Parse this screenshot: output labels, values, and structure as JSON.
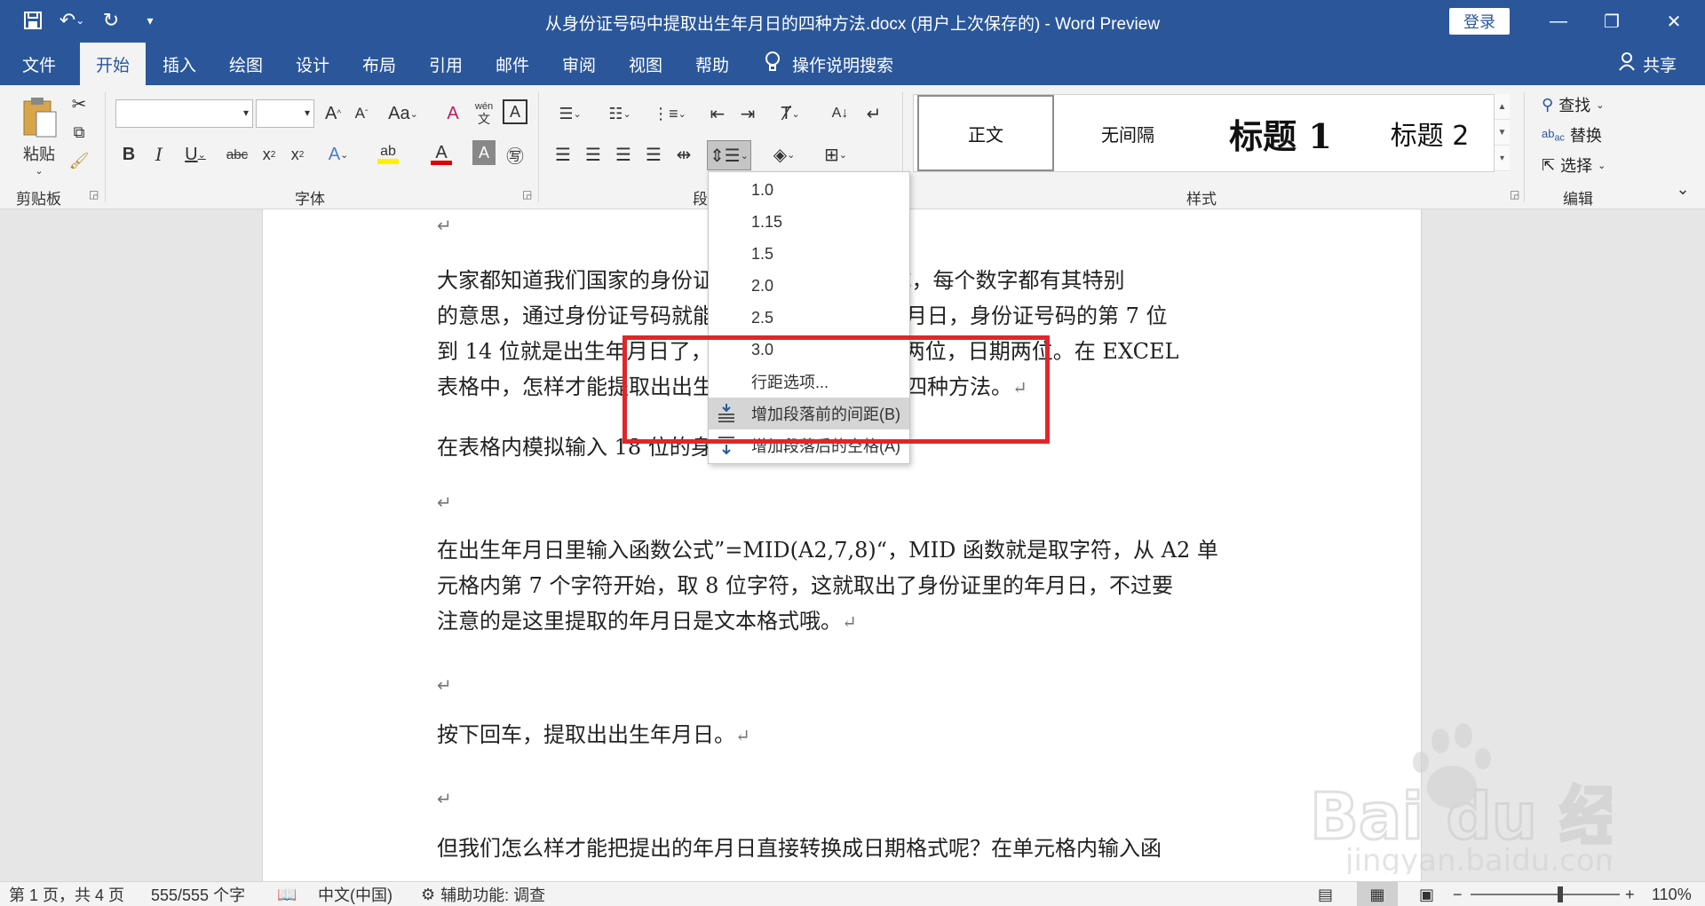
{
  "window": {
    "title": "从身份证号码中提取出生年月日的四种方法.docx (用户上次保存的)  -  Word Preview",
    "login_label": "登录"
  },
  "tabs": [
    {
      "label": "文件",
      "active": false
    },
    {
      "label": "开始",
      "active": true
    },
    {
      "label": "插入",
      "active": false
    },
    {
      "label": "绘图",
      "active": false
    },
    {
      "label": "设计",
      "active": false
    },
    {
      "label": "布局",
      "active": false
    },
    {
      "label": "引用",
      "active": false
    },
    {
      "label": "邮件",
      "active": false
    },
    {
      "label": "审阅",
      "active": false
    },
    {
      "label": "视图",
      "active": false
    },
    {
      "label": "帮助",
      "active": false
    }
  ],
  "tell_me": "操作说明搜索",
  "share_label": "共享",
  "ribbon": {
    "clipboard": {
      "paste_label": "粘贴",
      "group_label": "剪贴板"
    },
    "font": {
      "group_label": "字体",
      "name_value": "",
      "size_value": ""
    },
    "paragraph": {
      "group_label": "段"
    },
    "styles": {
      "group_label": "样式",
      "items": [
        "正文",
        "无间隔",
        "标题 1",
        "标题 2"
      ]
    },
    "editing": {
      "group_label": "编辑",
      "find_label": "查找",
      "replace_label": "替换",
      "select_label": "选择"
    }
  },
  "line_spacing_menu": {
    "options": [
      "1.0",
      "1.15",
      "1.5",
      "2.0",
      "2.5",
      "3.0"
    ],
    "line_spacing_options_label": "行距选项...",
    "add_space_before_label": "增加段落前的间距(B)",
    "add_space_after_label": "增加段落后的空格(A)"
  },
  "document": {
    "paragraphs": [
      "大家都知道我们国家的身份证号码由18位数字组成，每个数字都有其特别的意思，通过身份证号码就能看出一个人的出生年月日，身份证号码的第 7 位到 14 位就是出生年月日了，其中年份四位，月份两位，日期两位。在 EXCEL 表格中，怎样才能提取出出生年月日呢？下面介绍四种方法。",
      "在表格内模拟输入 18 位的身份证号码。",
      "在出生年月日里输入函数公式”=MID(A2,7,8)“，MID 函数就是取字符，从 A2 单元格内第 7 个字符开始，取 8 位字符，这就取出了身份证里的年月日，不过要注意的是这里提取的年月日是文本格式哦。",
      "按下回车，提取出出生年月日。",
      "但我们怎么样才能把提出的年月日直接转换成日期格式呢？在单元格内输入函"
    ],
    "para1_lines": [
      "大家都知道我们国家的身份证号码由18位数字组成，每个数字都有其特别",
      "的意思，通过身份证号码就能看出一个人的出生年月日，身份证号码的第 7 位",
      "到 14 位就是出生年月日了，其中年份四位，月份两位，日期两位。在 EXCEL",
      "表格中，怎样才能提取出出生年月日呢？下面介绍四种方法。"
    ],
    "para3_lines": [
      "在出生年月日里输入函数公式”=MID(A2,7,8)“，MID 函数就是取字符，从 A2 单",
      "元格内第 7 个字符开始，取 8 位字符，这就取出了身份证里的年月日，不过要",
      "注意的是这里提取的年月日是文本格式哦。"
    ],
    "paragraph_mark": "↵"
  },
  "statusbar": {
    "page_info": "第 1 页，共 4 页",
    "word_count": "555/555 个字",
    "language": "中文(中国)",
    "accessibility": "辅助功能: 调查",
    "zoom": "110%"
  },
  "watermark": {
    "text": "Bai du 经验",
    "url": "jingyan.baidu.com"
  },
  "colors": {
    "accent": "#2b579a",
    "highlight_box": "#e3242b"
  }
}
